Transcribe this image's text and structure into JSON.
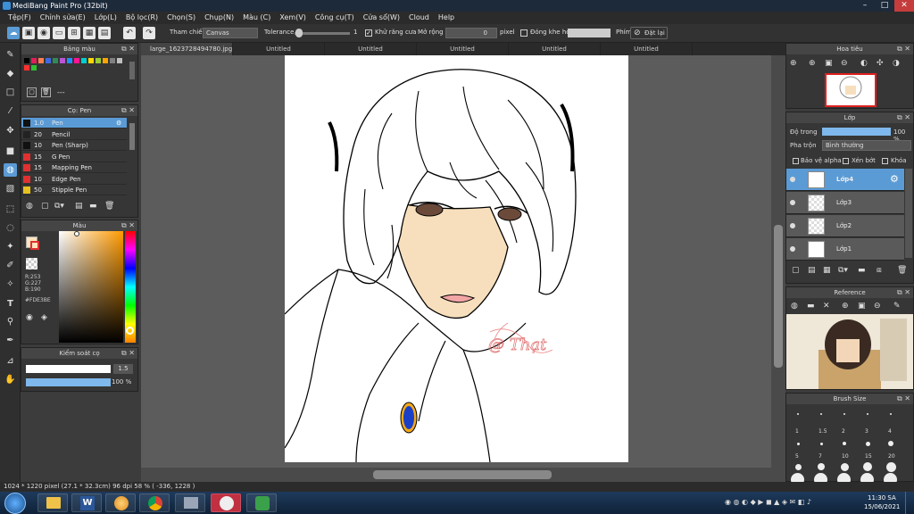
{
  "window": {
    "title": "MediBang Paint Pro (32bit)"
  },
  "menu": [
    "Tệp(F)",
    "Chỉnh sửa(E)",
    "Lớp(L)",
    "Bộ lọc(R)",
    "Chọn(S)",
    "Chụp(N)",
    "Màu (C)",
    "Xem(V)",
    "Công cụ(T)",
    "Cửa sổ(W)",
    "Cloud",
    "Help"
  ],
  "toolbar": {
    "ref_label": "Tham chiếu",
    "ref_value": "Canvas",
    "tolerance_label": "Tolerance",
    "tolerance_value": "1",
    "antialias_label": "Khử răng cưa",
    "expand_label": "Mở rộng",
    "expand_value": "0",
    "unit": "pixel",
    "close_gap_label": "Đóng khe hở",
    "brush_label": "Phím",
    "reset_label": "Đặt lại"
  },
  "panels": {
    "color_bar": {
      "title": "Bảng màu",
      "dash": "---"
    },
    "brush": {
      "title": "Cọ: Pen",
      "items": [
        {
          "size": "1.0",
          "name": "Pen",
          "color": "#111111",
          "selected": true
        },
        {
          "size": "20",
          "name": "Pencil",
          "color": "#222222"
        },
        {
          "size": "10",
          "name": "Pen (Sharp)",
          "color": "#111111"
        },
        {
          "size": "15",
          "name": "G Pen",
          "color": "#e03030"
        },
        {
          "size": "15",
          "name": "Mapping Pen",
          "color": "#e03030"
        },
        {
          "size": "10",
          "name": "Edge Pen",
          "color": "#e03030"
        },
        {
          "size": "50",
          "name": "Stipple Pen",
          "color": "#e8c020"
        }
      ]
    },
    "color": {
      "title": "Màu",
      "r": "R:253",
      "g": "G:227",
      "b": "B:190",
      "hex": "#FDE3BE",
      "fg": "#FDE3BE"
    },
    "brush_control": {
      "title": "Kiểm soát cọ",
      "size": "1.5",
      "opacity": "100 %",
      "opacity_pct": 100
    },
    "navigator": {
      "title": "Hoa tiêu"
    },
    "layer": {
      "title": "Lớp",
      "opacity_label": "Độ trong",
      "opacity_value": "100 %",
      "opacity_pct": 100,
      "blend_label": "Pha trộn",
      "blend_value": "Bình thường",
      "protect_alpha": "Bảo vệ alpha",
      "clipping": "Xén bớt",
      "lock": "Khóa",
      "layers": [
        {
          "name": "Lớp4",
          "selected": true
        },
        {
          "name": "Lớp3"
        },
        {
          "name": "Lớp2"
        },
        {
          "name": "Lớp1"
        }
      ]
    },
    "reference": {
      "title": "Reference"
    },
    "brush_size": {
      "title": "Brush Size",
      "row1": [
        "1",
        "1.5",
        "2",
        "3",
        "4"
      ],
      "row2": [
        "5",
        "7",
        "10",
        "15",
        "20"
      ]
    }
  },
  "tabs": [
    "large_1623728494780.jpg",
    "Untitled",
    "Untitled",
    "Untitled",
    "Untitled",
    "Untitled"
  ],
  "canvas": {
    "signature": "@ Thạt"
  },
  "status": "1024 * 1220 pixel   (27.1 * 32.3cm)   96 dpi   58 %   ( -336, 1228 )",
  "clock": {
    "time": "11:30 SA",
    "date": "15/06/2021"
  },
  "colors": {
    "accent": "#5b9bd5",
    "panel": "#363636",
    "dark": "#2b2b2b"
  }
}
